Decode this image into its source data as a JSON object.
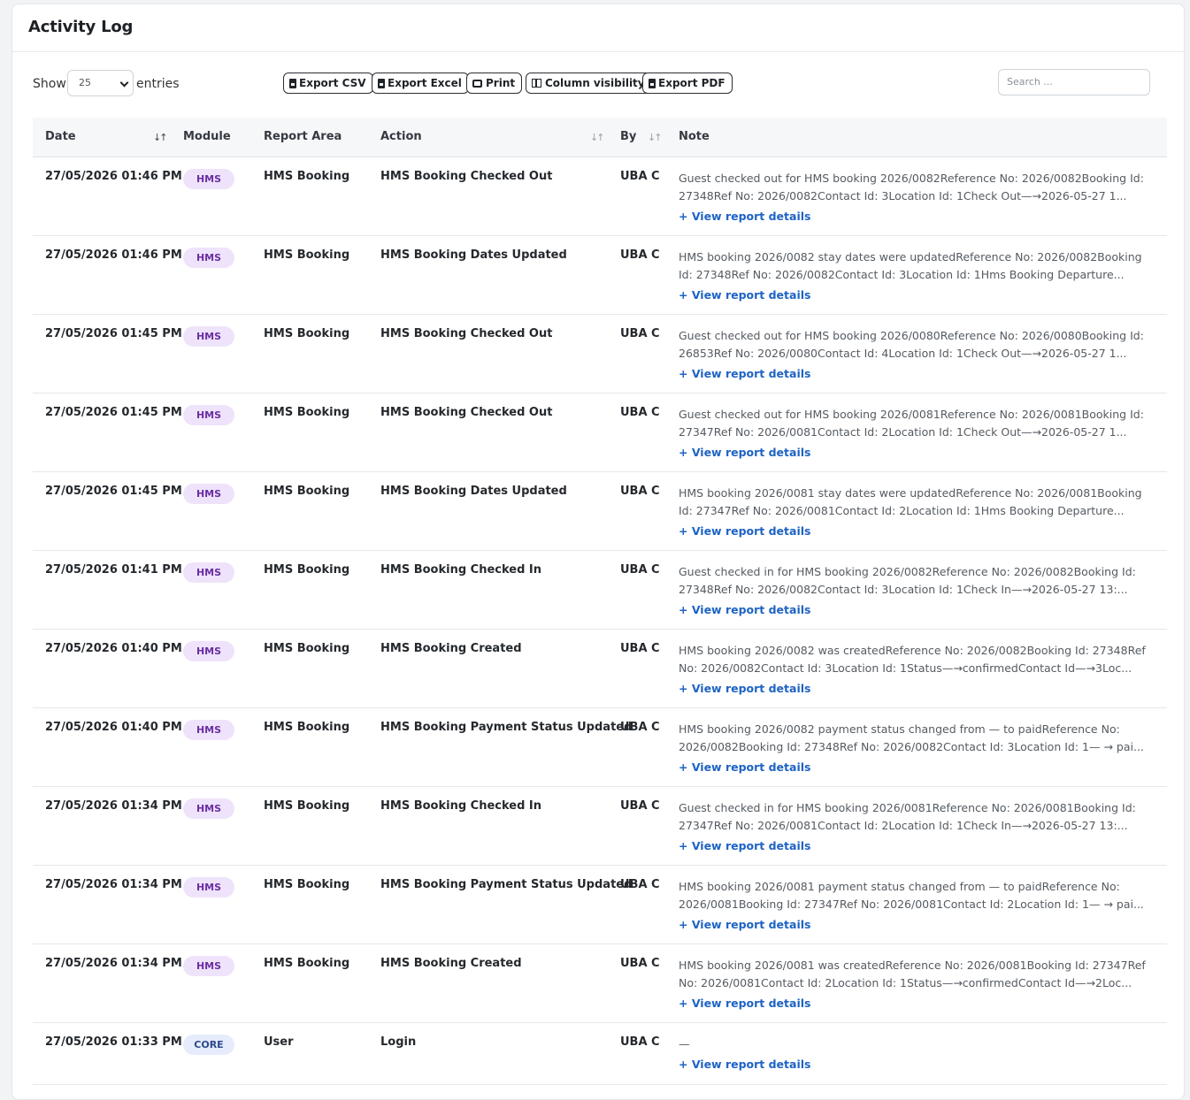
{
  "page": {
    "title": "Activity Log"
  },
  "toolbar": {
    "show_label": "Show",
    "page_length": "25",
    "entries_label": "entries",
    "buttons": [
      {
        "label": "Export CSV",
        "icon": "file-csv-icon"
      },
      {
        "label": "Export Excel",
        "icon": "file-excel-icon"
      },
      {
        "label": "Print",
        "icon": "print-icon"
      },
      {
        "label": "Column visibility",
        "icon": "columns-icon"
      },
      {
        "label": "Export PDF",
        "icon": "file-pdf-icon"
      }
    ],
    "search_placeholder": "Search ..."
  },
  "table": {
    "columns": [
      "Date",
      "Module",
      "Report Area",
      "Action",
      "By",
      "Note"
    ],
    "link_label": "+ View report details",
    "rows": [
      {
        "date": "27/05/2026 01:46 PM",
        "module": "HMS",
        "area": "HMS Booking",
        "action": "HMS Booking Checked Out",
        "by": "UBA C",
        "note": "Guest checked out for HMS booking 2026/0082Reference No: 2026/0082Booking Id: 27348Ref No: 2026/0082Contact Id: 3Location Id: 1Check Out—→2026-05-27 1..."
      },
      {
        "date": "27/05/2026 01:46 PM",
        "module": "HMS",
        "area": "HMS Booking",
        "action": "HMS Booking Dates Updated",
        "by": "UBA C",
        "note": "HMS booking 2026/0082 stay dates were updatedReference No: 2026/0082Booking Id: 27348Ref No: 2026/0082Contact Id: 3Location Id: 1Hms Booking Departure..."
      },
      {
        "date": "27/05/2026 01:45 PM",
        "module": "HMS",
        "area": "HMS Booking",
        "action": "HMS Booking Checked Out",
        "by": "UBA C",
        "note": "Guest checked out for HMS booking 2026/0080Reference No: 2026/0080Booking Id: 26853Ref No: 2026/0080Contact Id: 4Location Id: 1Check Out—→2026-05-27 1..."
      },
      {
        "date": "27/05/2026 01:45 PM",
        "module": "HMS",
        "area": "HMS Booking",
        "action": "HMS Booking Checked Out",
        "by": "UBA C",
        "note": "Guest checked out for HMS booking 2026/0081Reference No: 2026/0081Booking Id: 27347Ref No: 2026/0081Contact Id: 2Location Id: 1Check Out—→2026-05-27 1..."
      },
      {
        "date": "27/05/2026 01:45 PM",
        "module": "HMS",
        "area": "HMS Booking",
        "action": "HMS Booking Dates Updated",
        "by": "UBA C",
        "note": "HMS booking 2026/0081 stay dates were updatedReference No: 2026/0081Booking Id: 27347Ref No: 2026/0081Contact Id: 2Location Id: 1Hms Booking Departure..."
      },
      {
        "date": "27/05/2026 01:41 PM",
        "module": "HMS",
        "area": "HMS Booking",
        "action": "HMS Booking Checked In",
        "by": "UBA C",
        "note": "Guest checked in for HMS booking 2026/0082Reference No: 2026/0082Booking Id: 27348Ref No: 2026/0082Contact Id: 3Location Id: 1Check In—→2026-05-27 13:..."
      },
      {
        "date": "27/05/2026 01:40 PM",
        "module": "HMS",
        "area": "HMS Booking",
        "action": "HMS Booking Created",
        "by": "UBA C",
        "note": "HMS booking 2026/0082 was createdReference No: 2026/0082Booking Id: 27348Ref No: 2026/0082Contact Id: 3Location Id: 1Status—→confirmedContact Id—→3Loc..."
      },
      {
        "date": "27/05/2026 01:40 PM",
        "module": "HMS",
        "area": "HMS Booking",
        "action": "HMS Booking Payment Status Updated",
        "by": "UBA C",
        "note": "HMS booking 2026/0082 payment status changed from — to paidReference No: 2026/0082Booking Id: 27348Ref No: 2026/0082Contact Id: 3Location Id: 1— → pai..."
      },
      {
        "date": "27/05/2026 01:34 PM",
        "module": "HMS",
        "area": "HMS Booking",
        "action": "HMS Booking Checked In",
        "by": "UBA C",
        "note": "Guest checked in for HMS booking 2026/0081Reference No: 2026/0081Booking Id: 27347Ref No: 2026/0081Contact Id: 2Location Id: 1Check In—→2026-05-27 13:..."
      },
      {
        "date": "27/05/2026 01:34 PM",
        "module": "HMS",
        "area": "HMS Booking",
        "action": "HMS Booking Payment Status Updated",
        "by": "UBA C",
        "note": "HMS booking 2026/0081 payment status changed from — to paidReference No: 2026/0081Booking Id: 27347Ref No: 2026/0081Contact Id: 2Location Id: 1— → pai..."
      },
      {
        "date": "27/05/2026 01:34 PM",
        "module": "HMS",
        "area": "HMS Booking",
        "action": "HMS Booking Created",
        "by": "UBA C",
        "note": "HMS booking 2026/0081 was createdReference No: 2026/0081Booking Id: 27347Ref No: 2026/0081Contact Id: 2Location Id: 1Status—→confirmedContact Id—→2Loc..."
      },
      {
        "date": "27/05/2026 01:33 PM",
        "module": "CORE",
        "area": "User",
        "action": "Login",
        "by": "UBA C",
        "note": "—"
      }
    ]
  }
}
